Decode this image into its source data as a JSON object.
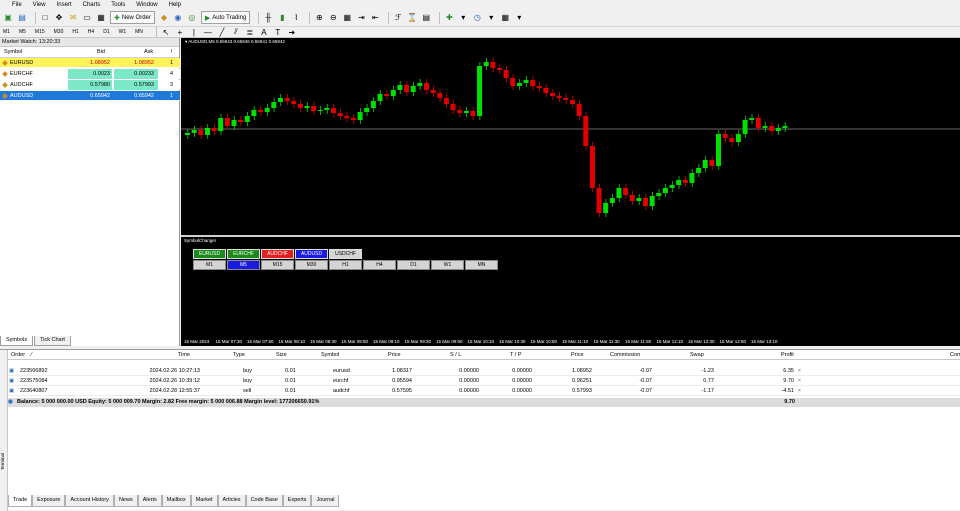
{
  "menu": [
    "File",
    "View",
    "Insert",
    "Charts",
    "Tools",
    "Window",
    "Help"
  ],
  "toolbar": {
    "new_order": "New Order",
    "auto_trading": "Auto Trading"
  },
  "timeframes": [
    "M1",
    "M5",
    "M15",
    "M30",
    "H1",
    "H4",
    "D1",
    "W1",
    "MN"
  ],
  "market_watch": {
    "title": "Market Watch: 13:20:33",
    "columns": [
      "Symbol",
      "Bid",
      "Ask",
      "!"
    ],
    "rows": [
      {
        "symbol": "EURUSD",
        "bid": "1.08952",
        "ask": "1.08952",
        "count": "1",
        "bg": "#fff35a"
      },
      {
        "symbol": "EURCHF",
        "bid": "0.0023",
        "ask": "0.00233",
        "count": "4",
        "bg": "#7de8c8"
      },
      {
        "symbol": "AUDCHF",
        "bid": "0.57980",
        "ask": "0.57993",
        "count": "3",
        "bg": "#7de8c8"
      },
      {
        "symbol": "AUDUSD",
        "bid": "0.65942",
        "ask": "0.65942",
        "count": "1",
        "bg": "#1e7ad6"
      }
    ],
    "tabs": [
      "Symbols",
      "Tick Chart"
    ]
  },
  "chart": {
    "label": "AUDUSD,M5  0.65943 0.65946 0.65941 0.65942",
    "x_labels": [
      "15 Mar 2024",
      "15 Mar 07:30",
      "15 Mar 07:50",
      "15 Mar 08:10",
      "15 Mar 08:30",
      "15 Mar 08:50",
      "15 Mar 09:10",
      "15 Mar 09:30",
      "15 Mar 09:50",
      "15 Mar 10:10",
      "15 Mar 10:30",
      "15 Mar 10:50",
      "15 Mar 11:10",
      "15 Mar 11:30",
      "15 Mar 11:50",
      "15 Mar 12:10",
      "15 Mar 12:30",
      "15 Mar 12:50",
      "15 Mar 13:10"
    ]
  },
  "symbol_changer": {
    "label": "SymbolChanger",
    "symbols": [
      {
        "name": "EURUSD",
        "color": "#1a8a1a"
      },
      {
        "name": "EURCHF",
        "color": "#1a8a1a"
      },
      {
        "name": "AUDCHF",
        "color": "#e02020"
      },
      {
        "name": "AUDUSD",
        "color": "#1a1ae0"
      },
      {
        "name": "USDCHF",
        "color": "#d4d4d4"
      }
    ],
    "timeframes": [
      "M1",
      "M5",
      "M15",
      "M30",
      "H1",
      "H4",
      "D1",
      "W1",
      "MN"
    ]
  },
  "terminal": {
    "columns": [
      "Order",
      "Time",
      "Type",
      "Size",
      "Symbol",
      "Price",
      "S / L",
      "T / P",
      "Price",
      "Commission",
      "Swap",
      "Profit",
      "Comment"
    ],
    "rows": [
      {
        "order": "223566892",
        "time": "2024.02.26 10:27:13",
        "type": "buy",
        "size": "0.01",
        "symbol": "eurusd",
        "price": "1.08317",
        "sl": "0.00000",
        "tp": "0.00000",
        "cprice": "1.08952",
        "commission": "-0.07",
        "swap": "-1.23",
        "profit": "6.35"
      },
      {
        "order": "223575084",
        "time": "2024.02.26 10:39:12",
        "type": "buy",
        "size": "0.01",
        "symbol": "eurchf",
        "price": "0.95594",
        "sl": "0.00000",
        "tp": "0.00000",
        "cprice": "0.96251",
        "commission": "-0.07",
        "swap": "0.77",
        "profit": "9.70"
      },
      {
        "order": "223640807",
        "time": "2024.02.28 12:55:37",
        "type": "sell",
        "size": "0.01",
        "symbol": "audchf",
        "price": "0.57595",
        "sl": "0.00000",
        "tp": "0.00000",
        "cprice": "0.57993",
        "commission": "-0.07",
        "swap": "-1.17",
        "profit": "-4.51"
      }
    ],
    "balance": "Balance: 5 000 000.00 USD  Equity: 5 000 009.70  Margin: 2.82  Free margin: 5 000 006.88  Margin level: 177206650.91%",
    "total": "9.70",
    "tabs": [
      "Trade",
      "Exposure",
      "Account History",
      "News",
      "Alerts",
      "Mailbox",
      "Market",
      "Articles",
      "Code Base",
      "Experts",
      "Journal"
    ],
    "side_label": "Terminal"
  },
  "colors": {
    "bull": "#00e000",
    "bear": "#e00000"
  }
}
